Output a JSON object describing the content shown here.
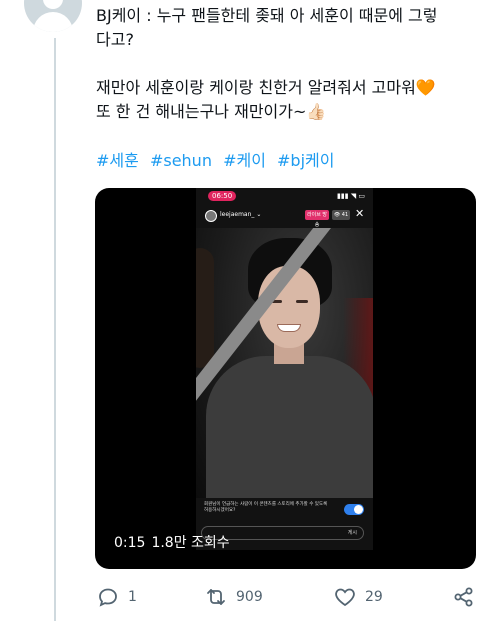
{
  "tweet": {
    "line1": "BJ케이 : 누구 팬들한테 좆돼 아 세훈이 때문에 그렇",
    "line2": "다고?",
    "line3": "재만아 세훈이랑 케이랑 친한거 알려줘서 고마워🧡",
    "line4": "또 한 건 해내는구나 재만이가~👍🏻",
    "hashtags": [
      "#세훈",
      "#sehun",
      "#케이",
      "#bj케이"
    ]
  },
  "media": {
    "status_time": "06:50",
    "status_icons": "▮▮▮ ◥ ▭",
    "ig_username": "leejaeman_ ⌄",
    "ig_live_badge": "라이브 방송",
    "ig_viewers": "👁 41",
    "ig_close": "✕",
    "toast_text": "회원님이 언급하는 사람이 이 콘텐츠를 스토리에 추가할 수 있도록 허용하시겠어요?",
    "post_label": "게시",
    "video_time": "0:15",
    "view_count": "1.8만 조회수",
    "toggle_on": true
  },
  "actions": {
    "reply_count": "1",
    "retweet_count": "909",
    "like_count": "29"
  },
  "icons": [
    "avatar-icon",
    "reply-icon",
    "retweet-icon",
    "like-icon",
    "share-icon"
  ],
  "colors": {
    "hashtag": "#1d9bf0",
    "muted": "#536471",
    "live": "#e1306c",
    "toggle": "#2f80ed",
    "like_fill": "#f4900c"
  }
}
